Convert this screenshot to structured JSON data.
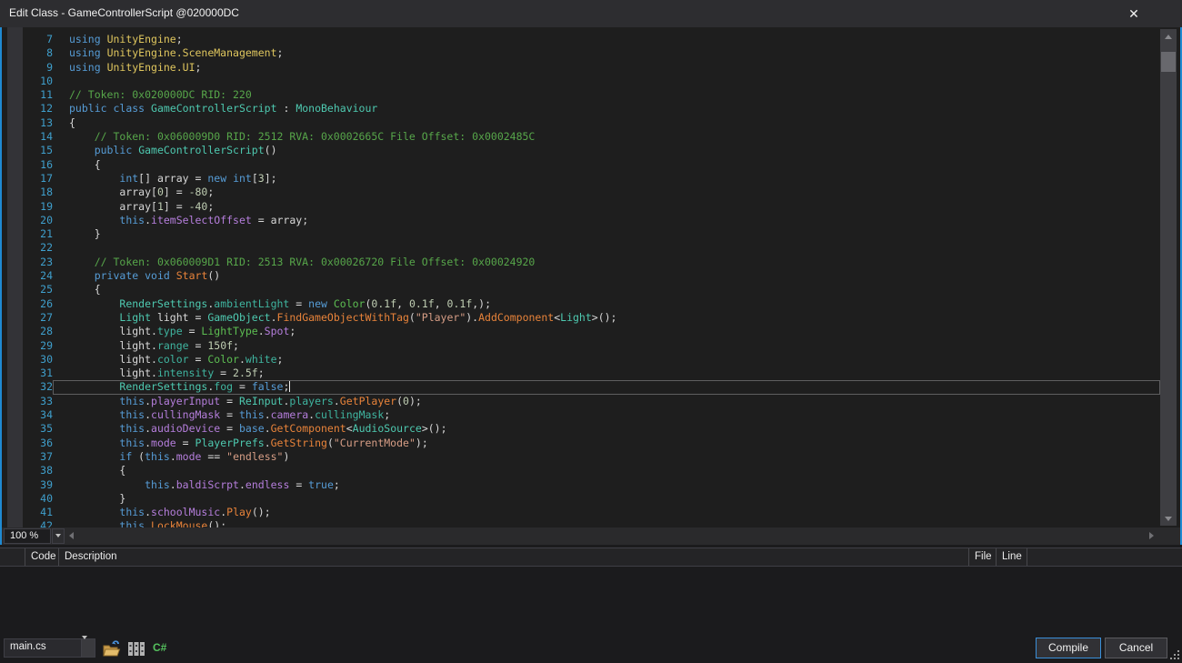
{
  "window": {
    "title": "Edit Class - GameControllerScript @020000DC",
    "close_glyph": "✕"
  },
  "editor": {
    "zoom_level": "100 %",
    "current_line": 32,
    "lines": [
      {
        "n": 7,
        "tokens": [
          [
            "kw",
            "using"
          ],
          [
            "pl",
            " "
          ],
          [
            "ns",
            "UnityEngine"
          ],
          [
            "pl",
            ";"
          ]
        ]
      },
      {
        "n": 8,
        "tokens": [
          [
            "kw",
            "using"
          ],
          [
            "pl",
            " "
          ],
          [
            "ns",
            "UnityEngine.SceneManagement"
          ],
          [
            "pl",
            ";"
          ]
        ]
      },
      {
        "n": 9,
        "tokens": [
          [
            "kw",
            "using"
          ],
          [
            "pl",
            " "
          ],
          [
            "ns",
            "UnityEngine.UI"
          ],
          [
            "pl",
            ";"
          ]
        ]
      },
      {
        "n": 10,
        "tokens": []
      },
      {
        "n": 11,
        "tokens": [
          [
            "cm",
            "// Token: 0x020000DC RID: 220"
          ]
        ]
      },
      {
        "n": 12,
        "tokens": [
          [
            "kw",
            "public"
          ],
          [
            "pl",
            " "
          ],
          [
            "kw",
            "class"
          ],
          [
            "pl",
            " "
          ],
          [
            "ty",
            "GameControllerScript"
          ],
          [
            "pl",
            " : "
          ],
          [
            "ty",
            "MonoBehaviour"
          ]
        ]
      },
      {
        "n": 13,
        "tokens": [
          [
            "pl",
            "{"
          ]
        ]
      },
      {
        "n": 14,
        "tokens": [
          [
            "pl",
            "    "
          ],
          [
            "cm",
            "// Token: 0x060009D0 RID: 2512 RVA: 0x0002665C File Offset: 0x0002485C"
          ]
        ]
      },
      {
        "n": 15,
        "tokens": [
          [
            "pl",
            "    "
          ],
          [
            "kw",
            "public"
          ],
          [
            "pl",
            " "
          ],
          [
            "ty",
            "GameControllerScript"
          ],
          [
            "pl",
            "()"
          ]
        ]
      },
      {
        "n": 16,
        "tokens": [
          [
            "pl",
            "    {"
          ]
        ]
      },
      {
        "n": 17,
        "tokens": [
          [
            "pl",
            "        "
          ],
          [
            "kw",
            "int"
          ],
          [
            "pl",
            "[] array = "
          ],
          [
            "kw",
            "new"
          ],
          [
            "pl",
            " "
          ],
          [
            "kw",
            "int"
          ],
          [
            "pl",
            "["
          ],
          [
            "num",
            "3"
          ],
          [
            "pl",
            "];"
          ]
        ]
      },
      {
        "n": 18,
        "tokens": [
          [
            "pl",
            "        array["
          ],
          [
            "num",
            "0"
          ],
          [
            "pl",
            "] = "
          ],
          [
            "num",
            "-80"
          ],
          [
            "pl",
            ";"
          ]
        ]
      },
      {
        "n": 19,
        "tokens": [
          [
            "pl",
            "        array["
          ],
          [
            "num",
            "1"
          ],
          [
            "pl",
            "] = "
          ],
          [
            "num",
            "-40"
          ],
          [
            "pl",
            ";"
          ]
        ]
      },
      {
        "n": 20,
        "tokens": [
          [
            "pl",
            "        "
          ],
          [
            "kw",
            "this"
          ],
          [
            "pl",
            "."
          ],
          [
            "fl",
            "itemSelectOffset"
          ],
          [
            "pl",
            " = array;"
          ]
        ]
      },
      {
        "n": 21,
        "tokens": [
          [
            "pl",
            "    }"
          ]
        ]
      },
      {
        "n": 22,
        "tokens": []
      },
      {
        "n": 23,
        "tokens": [
          [
            "pl",
            "    "
          ],
          [
            "cm",
            "// Token: 0x060009D1 RID: 2513 RVA: 0x00026720 File Offset: 0x00024920"
          ]
        ]
      },
      {
        "n": 24,
        "tokens": [
          [
            "pl",
            "    "
          ],
          [
            "kw",
            "private"
          ],
          [
            "pl",
            " "
          ],
          [
            "kw",
            "void"
          ],
          [
            "pl",
            " "
          ],
          [
            "me",
            "Start"
          ],
          [
            "pl",
            "()"
          ]
        ]
      },
      {
        "n": 25,
        "tokens": [
          [
            "pl",
            "    {"
          ]
        ]
      },
      {
        "n": 26,
        "tokens": [
          [
            "pl",
            "        "
          ],
          [
            "ty",
            "RenderSettings"
          ],
          [
            "pl",
            "."
          ],
          [
            "pr",
            "ambientLight"
          ],
          [
            "pl",
            " = "
          ],
          [
            "kw",
            "new"
          ],
          [
            "pl",
            " "
          ],
          [
            "st",
            "Color"
          ],
          [
            "pl",
            "("
          ],
          [
            "num",
            "0.1f"
          ],
          [
            "pl",
            ", "
          ],
          [
            "num",
            "0.1f"
          ],
          [
            "pl",
            ", "
          ],
          [
            "num",
            "0.1f"
          ],
          [
            "pl",
            ",);"
          ]
        ]
      },
      {
        "n": 27,
        "tokens": [
          [
            "pl",
            "        "
          ],
          [
            "ty",
            "Light"
          ],
          [
            "pl",
            " light = "
          ],
          [
            "ty",
            "GameObject"
          ],
          [
            "pl",
            "."
          ],
          [
            "me",
            "FindGameObjectWithTag"
          ],
          [
            "pl",
            "("
          ],
          [
            "str",
            "\"Player\""
          ],
          [
            "pl",
            ")."
          ],
          [
            "me",
            "AddComponent"
          ],
          [
            "pl",
            "<"
          ],
          [
            "ty",
            "Light"
          ],
          [
            "pl",
            ">();"
          ]
        ]
      },
      {
        "n": 28,
        "tokens": [
          [
            "pl",
            "        light."
          ],
          [
            "pr",
            "type"
          ],
          [
            "pl",
            " = "
          ],
          [
            "st",
            "LightType"
          ],
          [
            "pl",
            "."
          ],
          [
            "fl",
            "Spot"
          ],
          [
            "pl",
            ";"
          ]
        ]
      },
      {
        "n": 29,
        "tokens": [
          [
            "pl",
            "        light."
          ],
          [
            "pr",
            "range"
          ],
          [
            "pl",
            " = "
          ],
          [
            "num",
            "150f"
          ],
          [
            "pl",
            ";"
          ]
        ]
      },
      {
        "n": 30,
        "tokens": [
          [
            "pl",
            "        light."
          ],
          [
            "pr",
            "color"
          ],
          [
            "pl",
            " = "
          ],
          [
            "st",
            "Color"
          ],
          [
            "pl",
            "."
          ],
          [
            "pr",
            "white"
          ],
          [
            "pl",
            ";"
          ]
        ]
      },
      {
        "n": 31,
        "tokens": [
          [
            "pl",
            "        light."
          ],
          [
            "pr",
            "intensity"
          ],
          [
            "pl",
            " = "
          ],
          [
            "num",
            "2.5f"
          ],
          [
            "pl",
            ";"
          ]
        ]
      },
      {
        "n": 32,
        "tokens": [
          [
            "pl",
            "        "
          ],
          [
            "ty",
            "RenderSettings"
          ],
          [
            "pl",
            "."
          ],
          [
            "pr",
            "fog"
          ],
          [
            "pl",
            " = "
          ],
          [
            "kw",
            "false"
          ],
          [
            "pl",
            ";"
          ]
        ]
      },
      {
        "n": 33,
        "tokens": [
          [
            "pl",
            "        "
          ],
          [
            "kw",
            "this"
          ],
          [
            "pl",
            "."
          ],
          [
            "fl",
            "playerInput"
          ],
          [
            "pl",
            " = "
          ],
          [
            "ty",
            "ReInput"
          ],
          [
            "pl",
            "."
          ],
          [
            "pr",
            "players"
          ],
          [
            "pl",
            "."
          ],
          [
            "me",
            "GetPlayer"
          ],
          [
            "pl",
            "("
          ],
          [
            "num",
            "0"
          ],
          [
            "pl",
            ");"
          ]
        ]
      },
      {
        "n": 34,
        "tokens": [
          [
            "pl",
            "        "
          ],
          [
            "kw",
            "this"
          ],
          [
            "pl",
            "."
          ],
          [
            "fl",
            "cullingMask"
          ],
          [
            "pl",
            " = "
          ],
          [
            "kw",
            "this"
          ],
          [
            "pl",
            "."
          ],
          [
            "fl",
            "camera"
          ],
          [
            "pl",
            "."
          ],
          [
            "pr",
            "cullingMask"
          ],
          [
            "pl",
            ";"
          ]
        ]
      },
      {
        "n": 35,
        "tokens": [
          [
            "pl",
            "        "
          ],
          [
            "kw",
            "this"
          ],
          [
            "pl",
            "."
          ],
          [
            "fl",
            "audioDevice"
          ],
          [
            "pl",
            " = "
          ],
          [
            "kw",
            "base"
          ],
          [
            "pl",
            "."
          ],
          [
            "me",
            "GetComponent"
          ],
          [
            "pl",
            "<"
          ],
          [
            "ty",
            "AudioSource"
          ],
          [
            "pl",
            ">();"
          ]
        ]
      },
      {
        "n": 36,
        "tokens": [
          [
            "pl",
            "        "
          ],
          [
            "kw",
            "this"
          ],
          [
            "pl",
            "."
          ],
          [
            "fl",
            "mode"
          ],
          [
            "pl",
            " = "
          ],
          [
            "ty",
            "PlayerPrefs"
          ],
          [
            "pl",
            "."
          ],
          [
            "me",
            "GetString"
          ],
          [
            "pl",
            "("
          ],
          [
            "str",
            "\"CurrentMode\""
          ],
          [
            "pl",
            ");"
          ]
        ]
      },
      {
        "n": 37,
        "tokens": [
          [
            "pl",
            "        "
          ],
          [
            "kw",
            "if"
          ],
          [
            "pl",
            " ("
          ],
          [
            "kw",
            "this"
          ],
          [
            "pl",
            "."
          ],
          [
            "fl",
            "mode"
          ],
          [
            "pl",
            " == "
          ],
          [
            "str",
            "\"endless\""
          ],
          [
            "pl",
            ")"
          ]
        ]
      },
      {
        "n": 38,
        "tokens": [
          [
            "pl",
            "        {"
          ]
        ]
      },
      {
        "n": 39,
        "tokens": [
          [
            "pl",
            "            "
          ],
          [
            "kw",
            "this"
          ],
          [
            "pl",
            "."
          ],
          [
            "fl",
            "baldiScrpt"
          ],
          [
            "pl",
            "."
          ],
          [
            "fl",
            "endless"
          ],
          [
            "pl",
            " = "
          ],
          [
            "kw",
            "true"
          ],
          [
            "pl",
            ";"
          ]
        ]
      },
      {
        "n": 40,
        "tokens": [
          [
            "pl",
            "        }"
          ]
        ]
      },
      {
        "n": 41,
        "tokens": [
          [
            "pl",
            "        "
          ],
          [
            "kw",
            "this"
          ],
          [
            "pl",
            "."
          ],
          [
            "fl",
            "schoolMusic"
          ],
          [
            "pl",
            "."
          ],
          [
            "me",
            "Play"
          ],
          [
            "pl",
            "();"
          ]
        ]
      },
      {
        "n": 42,
        "tokens": [
          [
            "pl",
            "        "
          ],
          [
            "kw",
            "this"
          ],
          [
            "pl",
            "."
          ],
          [
            "me",
            "LockMouse"
          ],
          [
            "pl",
            "();"
          ]
        ]
      }
    ]
  },
  "error_list": {
    "columns": [
      "",
      "Code",
      "Description",
      "File",
      "Line"
    ]
  },
  "footer": {
    "file_selector_value": "main.cs",
    "icons": [
      "open-folder-icon",
      "assembly-references-icon",
      "csharp-icon"
    ],
    "csharp_glyph": "C#",
    "compile_label": "Compile",
    "cancel_label": "Cancel"
  },
  "colors": {
    "editor_focus_border": "#1F8AD2",
    "compile_button_border": "#3A8FD9",
    "title_bar": "#2D2D30",
    "editor_background": "#1E1E1E",
    "keyword": "#569CD6",
    "comment": "#57A64A",
    "type": "#4EC9B0",
    "field": "#B57EDC",
    "method": "#E8833A",
    "string": "#D69D85",
    "namespace": "#DFC65E"
  }
}
